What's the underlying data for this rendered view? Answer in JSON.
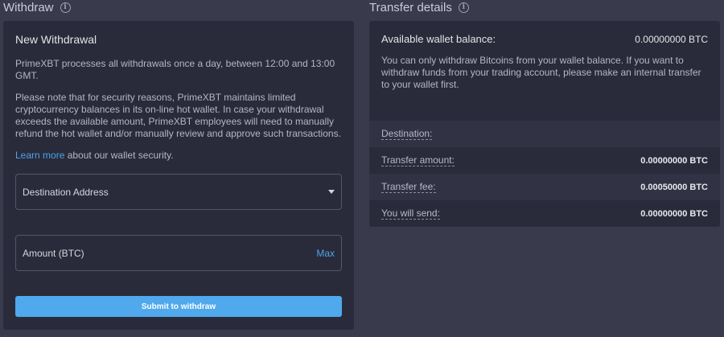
{
  "withdraw": {
    "title": "Withdraw",
    "panel": {
      "heading": "New Withdrawal",
      "paragraph1": "PrimeXBT processes all withdrawals once a day, between 12:00 and 13:00 GMT.",
      "paragraph2": "Please note that for security reasons, PrimeXBT maintains limited cryptocurrency balances in its on-line hot wallet. In case your withdrawal exceeds the available amount, PrimeXBT employees will need to manually refund the hot wallet and/or manually review and approve such transactions.",
      "learn_more_link": "Learn more",
      "learn_more_suffix": " about our wallet security.",
      "destination_label": "Destination Address",
      "amount_label": "Amount (BTC)",
      "max_label": "Max",
      "submit_label": "Submit to withdraw"
    }
  },
  "transfer": {
    "title": "Transfer details",
    "balance_label": "Available wallet balance:",
    "balance_value": "0.00000000 BTC",
    "note": "You can only withdraw Bitcoins from your wallet balance. If you want to withdraw funds from your trading account, please make an internal transfer to your wallet first.",
    "rows": [
      {
        "label": "Destination:",
        "value": ""
      },
      {
        "label": "Transfer amount:",
        "value": "0.00000000 BTC"
      },
      {
        "label": "Transfer fee:",
        "value": "0.00050000 BTC"
      },
      {
        "label": "You will send:",
        "value": "0.00000000 BTC"
      }
    ]
  },
  "icons": {
    "info": "i"
  },
  "colors": {
    "accent": "#4fa9ec",
    "link": "#4aa3e8",
    "panel_bg": "#2a2b3a",
    "page_bg": "#393a4c"
  }
}
